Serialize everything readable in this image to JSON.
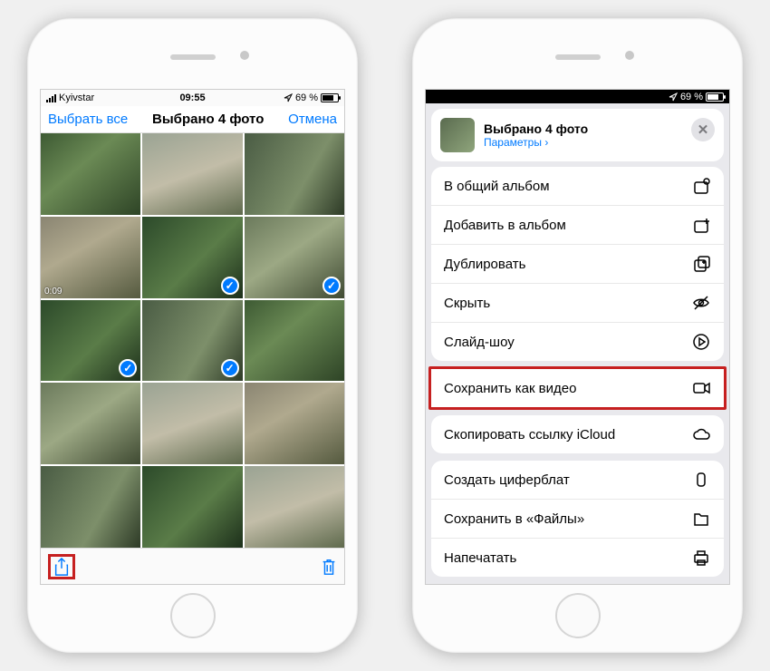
{
  "phone1": {
    "status": {
      "carrier": "Kyivstar",
      "time": "09:55",
      "battery_text": "69 %"
    },
    "nav": {
      "select_all": "Выбрать все",
      "title": "Выбрано 4 фото",
      "cancel": "Отмена"
    },
    "tiles": [
      {
        "bg": "g1",
        "selected": false
      },
      {
        "bg": "g2",
        "selected": false
      },
      {
        "bg": "g3",
        "selected": false
      },
      {
        "bg": "g4",
        "selected": false,
        "duration": "0:09"
      },
      {
        "bg": "g5",
        "selected": true
      },
      {
        "bg": "g6",
        "selected": true
      },
      {
        "bg": "g5",
        "selected": true
      },
      {
        "bg": "g3",
        "selected": true
      },
      {
        "bg": "g1",
        "selected": false
      },
      {
        "bg": "g6",
        "selected": false
      },
      {
        "bg": "g2",
        "selected": false
      },
      {
        "bg": "g4",
        "selected": false
      },
      {
        "bg": "g3",
        "selected": false
      },
      {
        "bg": "g5",
        "selected": false
      },
      {
        "bg": "g2",
        "selected": false
      }
    ]
  },
  "phone2": {
    "status": {
      "battery_text": "69 %"
    },
    "header": {
      "title": "Выбрано 4 фото",
      "options": "Параметры",
      "chevron": "›"
    },
    "groups": [
      [
        {
          "label": "В общий альбом",
          "icon": "shared-album"
        },
        {
          "label": "Добавить в альбом",
          "icon": "add-album"
        },
        {
          "label": "Дублировать",
          "icon": "duplicate"
        },
        {
          "label": "Скрыть",
          "icon": "hide"
        },
        {
          "label": "Слайд-шоу",
          "icon": "slideshow"
        }
      ],
      [
        {
          "label": "Сохранить как видео",
          "icon": "video",
          "highlight": true
        }
      ],
      [
        {
          "label": "Скопировать ссылку iCloud",
          "icon": "icloud"
        }
      ],
      [
        {
          "label": "Создать циферблат",
          "icon": "watch"
        },
        {
          "label": "Сохранить в «Файлы»",
          "icon": "files"
        },
        {
          "label": "Напечатать",
          "icon": "print"
        }
      ]
    ]
  }
}
